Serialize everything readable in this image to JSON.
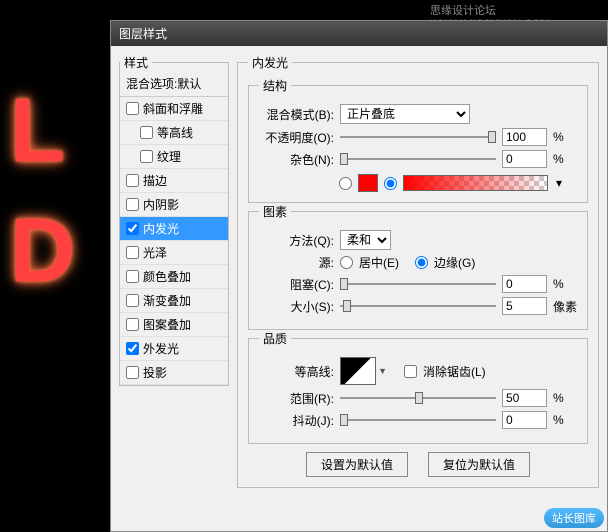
{
  "watermark_top": "思缘设计论坛  WWW.MISSYUAN.COM",
  "watermark_bottom": "站长图库",
  "neon": {
    "l": "L",
    "d": "D"
  },
  "dialog": {
    "title": "图层样式"
  },
  "styles": {
    "legend": "样式",
    "blend_header": "混合选项:默认",
    "items": [
      {
        "label": "斜面和浮雕",
        "checked": false
      },
      {
        "label": "等高线",
        "checked": false,
        "indent": true
      },
      {
        "label": "纹理",
        "checked": false,
        "indent": true
      },
      {
        "label": "描边",
        "checked": false
      },
      {
        "label": "内阴影",
        "checked": false
      },
      {
        "label": "内发光",
        "checked": true,
        "selected": true
      },
      {
        "label": "光泽",
        "checked": false
      },
      {
        "label": "颜色叠加",
        "checked": false
      },
      {
        "label": "渐变叠加",
        "checked": false
      },
      {
        "label": "图案叠加",
        "checked": false
      },
      {
        "label": "外发光",
        "checked": true
      },
      {
        "label": "投影",
        "checked": false
      }
    ]
  },
  "inner_glow": {
    "legend": "内发光",
    "structure": {
      "legend": "结构",
      "blend_mode_label": "混合模式(B):",
      "blend_mode_value": "正片叠底",
      "opacity_label": "不透明度(O):",
      "opacity_value": "100",
      "noise_label": "杂色(N):",
      "noise_value": "0",
      "percent": "%"
    },
    "elements": {
      "legend": "图素",
      "technique_label": "方法(Q):",
      "technique_value": "柔和",
      "source_label": "源:",
      "source_center": "居中(E)",
      "source_edge": "边缘(G)",
      "choke_label": "阻塞(C):",
      "choke_value": "0",
      "size_label": "大小(S):",
      "size_value": "5",
      "px": "像素",
      "percent": "%"
    },
    "quality": {
      "legend": "品质",
      "contour_label": "等高线:",
      "antialias_label": "消除锯齿(L)",
      "range_label": "范围(R):",
      "range_value": "50",
      "jitter_label": "抖动(J):",
      "jitter_value": "0",
      "percent": "%"
    },
    "buttons": {
      "default": "设置为默认值",
      "reset": "复位为默认值"
    }
  }
}
